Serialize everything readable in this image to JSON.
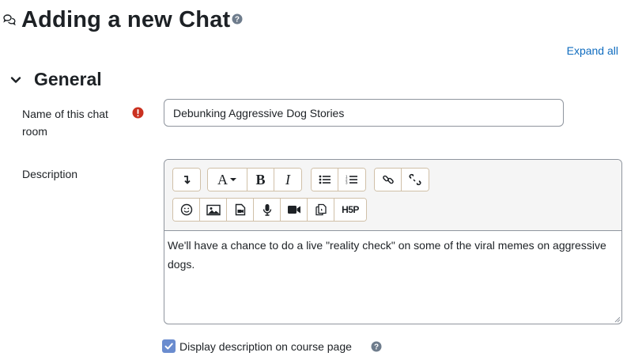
{
  "header": {
    "title": "Adding a new Chat",
    "icon": "chat-bubbles-icon",
    "help_icon": "question-circle-icon"
  },
  "expand_all_label": "Expand all",
  "section": {
    "title": "General",
    "toggle_icon": "chevron-down-icon"
  },
  "form": {
    "name": {
      "label_line1": "Name of this chat",
      "label_line2": "room",
      "value": "Debunking Aggressive Dog Stories",
      "required_icon": "exclamation-circle-icon"
    },
    "description": {
      "label": "Description",
      "content": "We'll have a chance to do a live \"reality check\" on some of the viral memes on aggressive dogs."
    },
    "display_description": {
      "label": "Display description on course page",
      "checked": true
    }
  },
  "toolbar": {
    "row1": [
      {
        "name": "collapse-toolbar-icon"
      },
      {
        "name": "font-style-icon",
        "label": "A"
      },
      {
        "name": "bold-icon",
        "label": "B"
      },
      {
        "name": "italic-icon",
        "label": "I"
      },
      {
        "name": "unordered-list-icon"
      },
      {
        "name": "ordered-list-icon"
      },
      {
        "name": "link-icon"
      },
      {
        "name": "unlink-icon"
      }
    ],
    "row2": [
      {
        "name": "emoticon-icon"
      },
      {
        "name": "image-icon"
      },
      {
        "name": "media-icon"
      },
      {
        "name": "record-audio-icon"
      },
      {
        "name": "record-video-icon"
      },
      {
        "name": "manage-files-icon"
      },
      {
        "name": "h5p-icon",
        "label": "H5P"
      }
    ]
  },
  "colors": {
    "link": "#0f6cbf",
    "required": "#ca3120",
    "help": "#0f6cbf",
    "checkbox": "#6a8ccf"
  }
}
